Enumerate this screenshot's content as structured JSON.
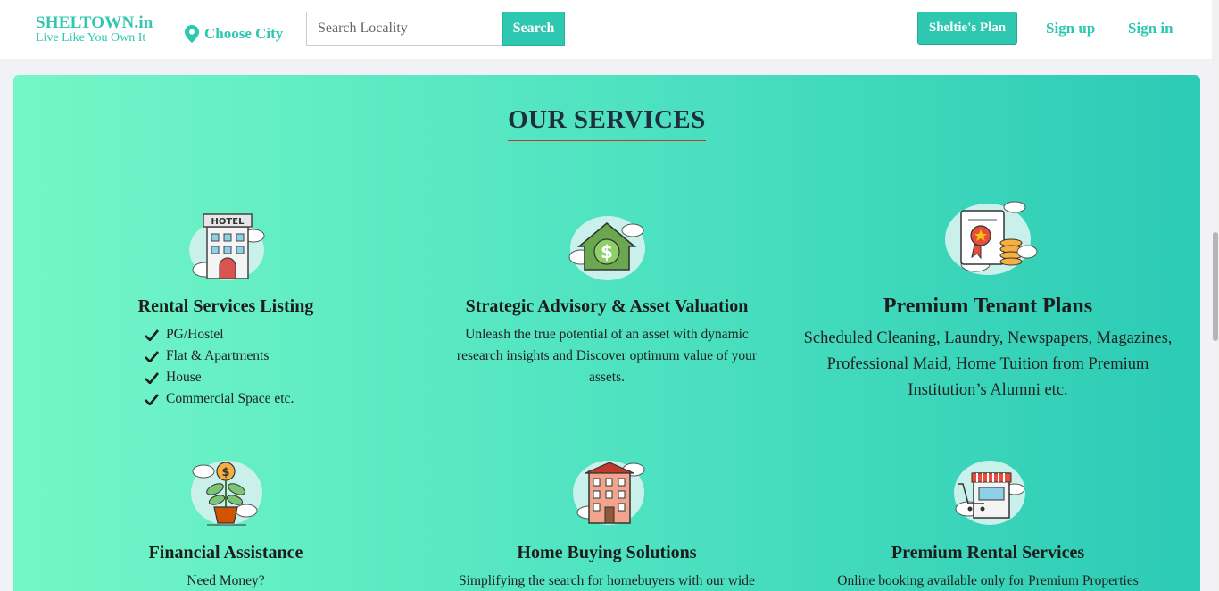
{
  "header": {
    "brand_name": "SHELTOWN.in",
    "brand_tagline": "Live Like You Own It",
    "city_label": "Choose City",
    "search_placeholder": "Search Locality",
    "search_button": "Search",
    "plan_button": "Sheltie's Plan",
    "signup_label": "Sign up",
    "signin_label": "Sign in"
  },
  "services": {
    "title": "OUR SERVICES",
    "cards": [
      {
        "title": "Rental Services Listing",
        "icon": "hotel-icon",
        "items": [
          "PG/Hostel",
          "Flat & Apartments",
          "House",
          "Commercial Space etc."
        ]
      },
      {
        "title": "Strategic Advisory & Asset Valuation",
        "icon": "house-dollar-icon",
        "line1": "Unleash the true potential of an asset with dynamic",
        "line2": "research insights and Discover optimum value of your",
        "line3": "assets."
      },
      {
        "title": "Premium Tenant Plans",
        "icon": "certificate-coins-icon",
        "line1": "Scheduled Cleaning, Laundry, Newspapers, Magazines,",
        "line2": "Professional Maid, Home Tuition from Premium",
        "line3": "Institution’s Alumni etc."
      },
      {
        "title": "Financial Assistance",
        "icon": "money-plant-icon",
        "line1": "Need Money?"
      },
      {
        "title": "Home Buying Solutions",
        "icon": "building-icon",
        "line1": "Simplifying the search for homebuyers with our wide"
      },
      {
        "title": "Premium Rental Services",
        "icon": "store-cart-icon",
        "line1": "Online booking available only for Premium Properties"
      }
    ]
  },
  "colors": {
    "brand": "#2ec7b0",
    "title_underline": "#c0392b",
    "panel_start": "#74f6c7",
    "panel_end": "#2ccbb5"
  }
}
